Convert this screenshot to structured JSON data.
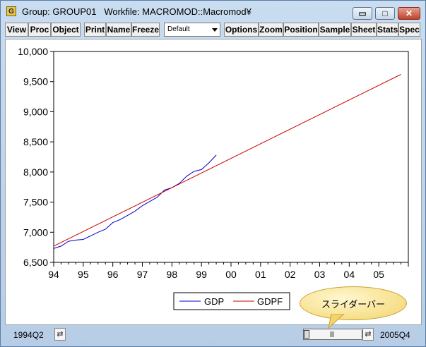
{
  "window": {
    "icon_letter": "G",
    "title": "Group: GROUP01   Workfile: MACROMOD::Macromod¥",
    "minimize_glyph": "▭",
    "maximize_glyph": "□",
    "close_glyph": "✕"
  },
  "toolbar": {
    "view": "View",
    "proc": "Proc",
    "object": "Object",
    "print": "Print",
    "name": "Name",
    "freeze": "Freeze",
    "default_select": "Default",
    "options": "Options",
    "zoom": "Zoom",
    "position": "Position",
    "sample": "Sample",
    "sheet": "Sheet",
    "stats": "Stats",
    "spec": "Spec"
  },
  "chart_data": {
    "type": "line",
    "ylim": [
      6500,
      10000
    ],
    "yticks": [
      "6,500",
      "7,000",
      "7,500",
      "8,000",
      "8,500",
      "9,000",
      "9,500",
      "10,000"
    ],
    "yticks_values": [
      6500,
      7000,
      7500,
      8000,
      8500,
      9000,
      9500,
      10000
    ],
    "xlabels": [
      "94",
      "95",
      "96",
      "97",
      "98",
      "99",
      "00",
      "01",
      "02",
      "03",
      "04",
      "05"
    ],
    "xlim": [
      1994.0,
      2006.0
    ],
    "series": [
      {
        "name": "GDP",
        "color": "#0000cc",
        "x": [
          1994.0,
          1994.25,
          1994.5,
          1994.75,
          1995.0,
          1995.25,
          1995.5,
          1995.75,
          1996.0,
          1996.25,
          1996.5,
          1996.75,
          1997.0,
          1997.25,
          1997.5,
          1997.75,
          1998.0,
          1998.25,
          1998.5,
          1998.75,
          1999.0,
          1999.25,
          1999.5
        ],
        "values": [
          6730,
          6770,
          6850,
          6870,
          6880,
          6940,
          7000,
          7050,
          7160,
          7210,
          7280,
          7350,
          7440,
          7510,
          7580,
          7700,
          7740,
          7810,
          7930,
          8010,
          8040,
          8150,
          8280
        ]
      },
      {
        "name": "GDPF",
        "color": "#cc0000",
        "x": [
          1994.0,
          2005.75
        ],
        "values": [
          6770,
          9620
        ]
      }
    ]
  },
  "legend": {
    "gdp": "GDP",
    "gdpf": "GDPF"
  },
  "status": {
    "start": "1994Q2",
    "end": "2005Q4",
    "nav_glyph": "⇄"
  },
  "callout": {
    "text": "スライダーバー"
  }
}
